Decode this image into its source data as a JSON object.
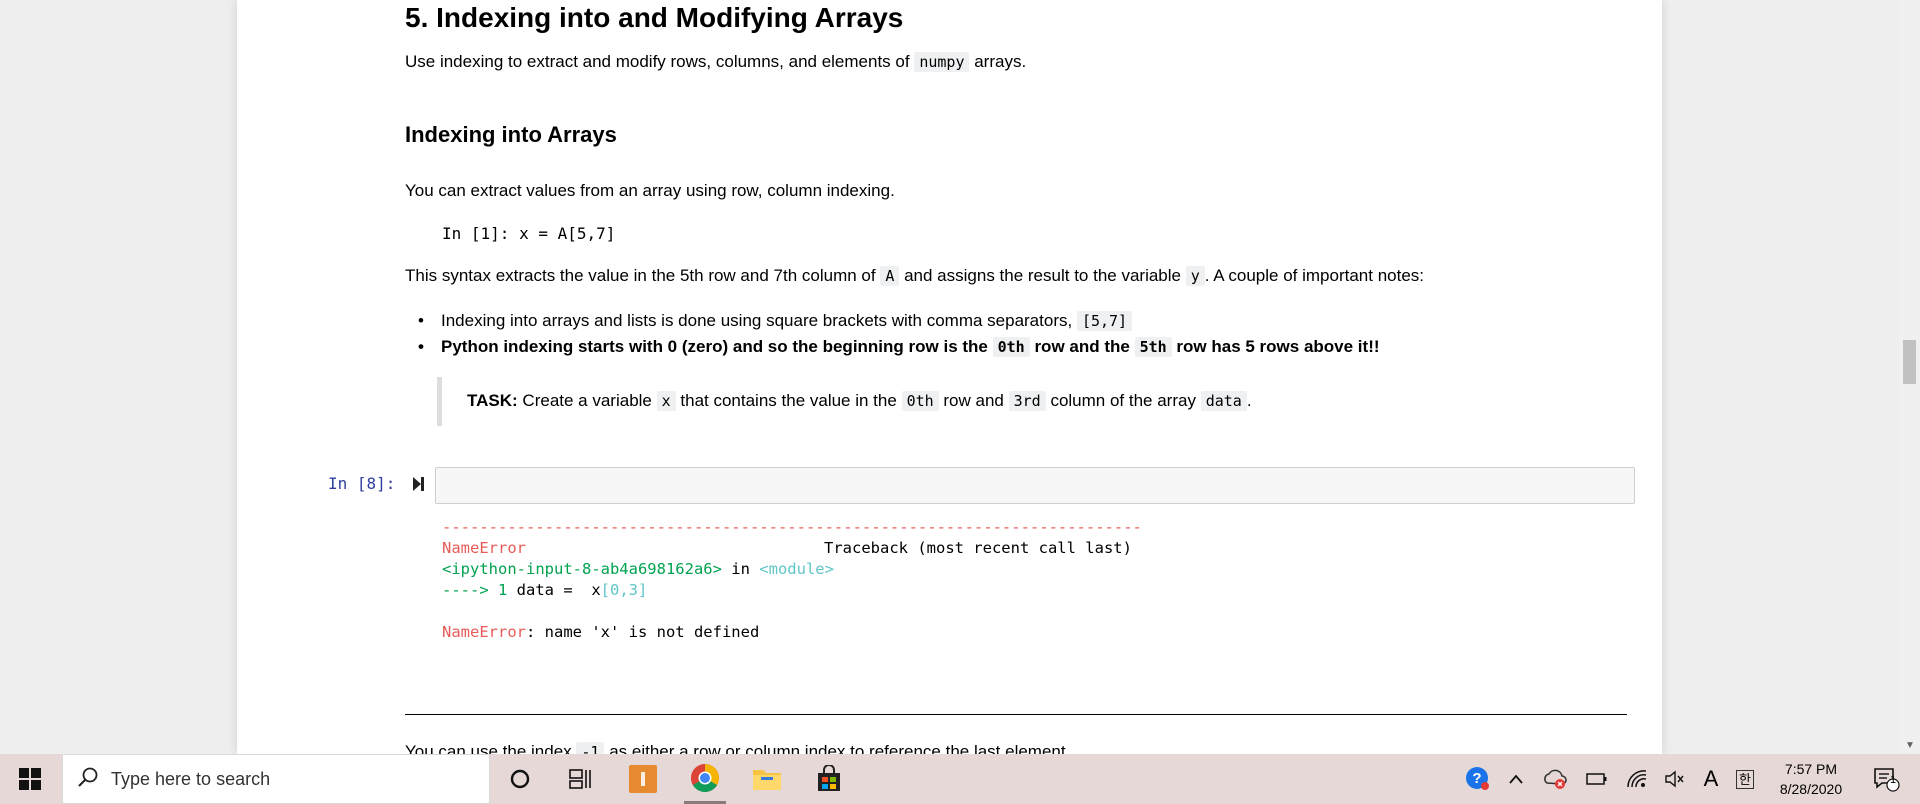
{
  "notebook": {
    "heading": "5. Indexing into and Modifying Arrays",
    "intro": {
      "before": "Use indexing to extract and modify rows, columns, and elements of",
      "code": "numpy",
      "after": "arrays."
    },
    "subheading": "Indexing into Arrays",
    "para1": "You can extract values from an array using row, column indexing.",
    "code_example": "In  [1]: x =  A[5,7]",
    "para2": {
      "t1": "This syntax extracts the value in the 5th row and 7th column of",
      "c1": "A",
      "t2": "and assigns the result to the variable",
      "c2": "y",
      "t3": ". A couple of important notes:"
    },
    "bullets": {
      "b1_text": "Indexing into arrays and lists is done using square brackets with comma separators,",
      "b1_code": "[5,7]",
      "b2_t1": "Python indexing starts with 0 (zero) and so the beginning row is the",
      "b2_c1": "0th",
      "b2_t2": "row and the",
      "b2_c2": "5th",
      "b2_t3": "row has 5 rows above it!!"
    },
    "task": {
      "label": "TASK:",
      "t1": "Create a variable",
      "c1": "x",
      "t2": "that contains the value in the",
      "c2": "0th",
      "t3": "row and",
      "c3": "3rd",
      "t4": "column of the array",
      "c4": "data",
      "t5": "."
    },
    "cell": {
      "prompt": "In [8]:",
      "input_value": ""
    },
    "output": {
      "dashes": "---------------------------------------------------------------------------",
      "err_name": "NameError",
      "traceback_label": "Traceback (most recent call last)",
      "file": "<ipython-input-8-ab4a698162a6>",
      "in_word": " in ",
      "module": "<module>",
      "arrow": "---->",
      "line_no": " 1 ",
      "line_code_a": "data =  x",
      "line_code_b": "[0,3]",
      "err_name2": "NameError",
      "err_msg": ": name 'x' is not defined"
    },
    "trailing": {
      "t1": "You can use the index",
      "c1": "-1",
      "t2": "as either a row or column index to reference the last element."
    }
  },
  "taskbar": {
    "search_placeholder": "Type here to search",
    "icons": [
      "windows-start-icon",
      "search-icon",
      "cortana-icon",
      "task-view-icon",
      "sublime-icon",
      "chrome-icon",
      "file-explorer-icon",
      "store-icon"
    ],
    "tray": {
      "time": "7:57 PM",
      "date": "8/28/2020",
      "ime_latin": "A",
      "ime_korean": "한",
      "notification_count": "1"
    }
  },
  "colors": {
    "prompt": "#303f9f",
    "error": "#e75c58",
    "green": "#00a250",
    "cyan": "#60c6c8",
    "taskbar": "#e6d8d6"
  }
}
